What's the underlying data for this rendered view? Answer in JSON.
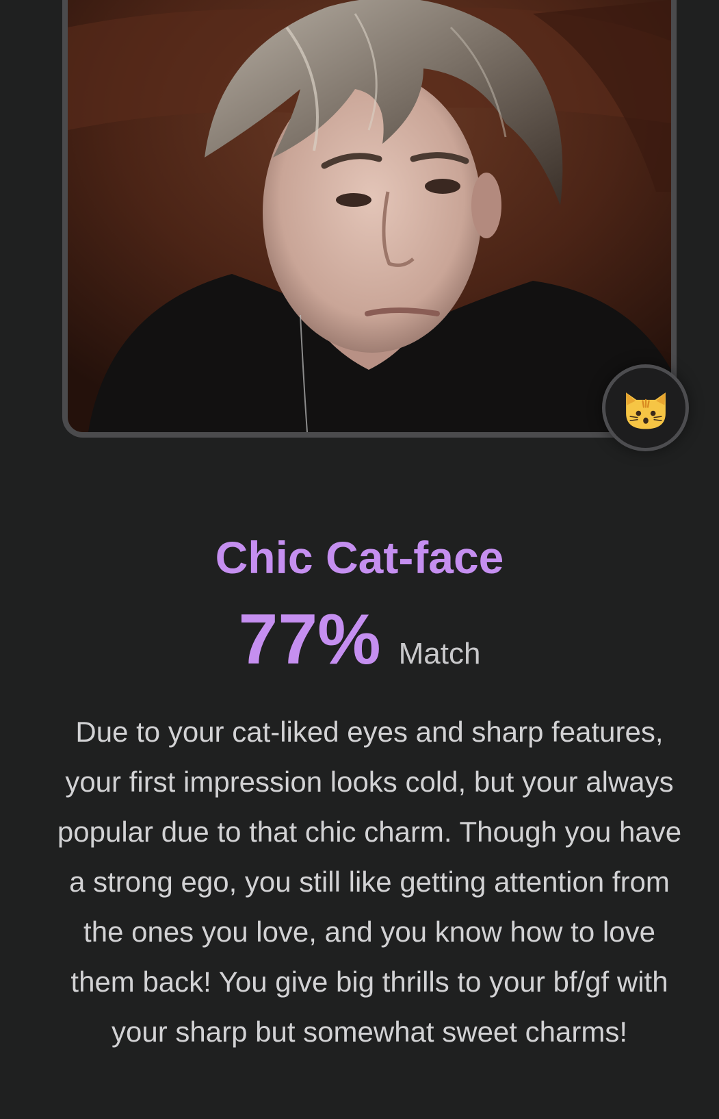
{
  "result": {
    "title": "Chic Cat-face",
    "match_value": "77%",
    "match_label": "Match",
    "description": "Due to your cat-liked eyes and sharp features, your first impression looks cold, but your always popular due to that chic charm. Though you have a strong ego, you still like getting attention from the ones you love, and you know how to love them back! You give big thrills to your bf/gf with your sharp but somewhat sweet charms!",
    "badge_icon": "cat-face-icon"
  },
  "colors": {
    "background": "#1f2020",
    "accent": "#c58ff0",
    "frame_border": "#4b4b4d",
    "text": "#d2d2d4"
  }
}
